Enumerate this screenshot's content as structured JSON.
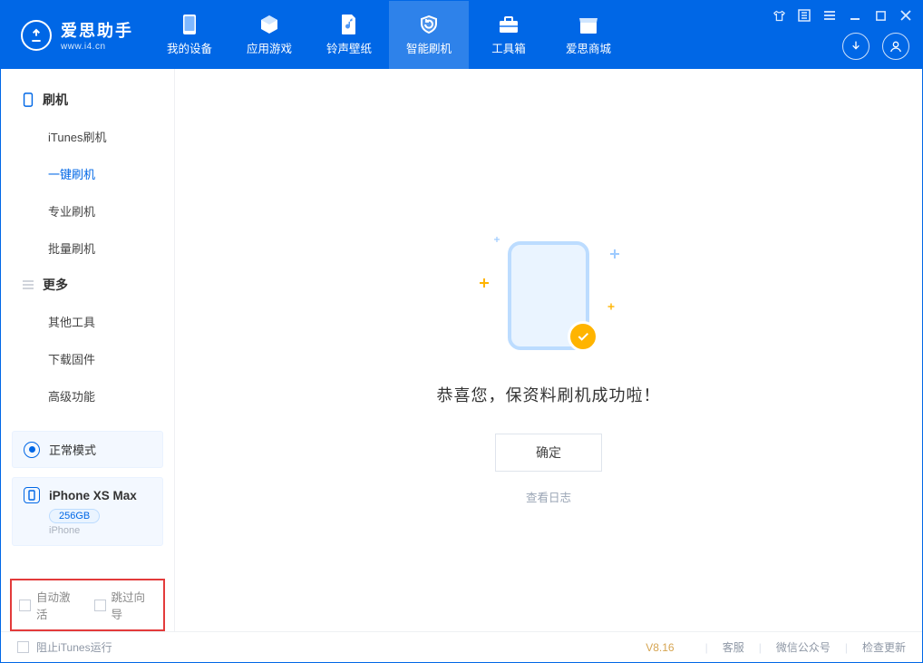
{
  "app": {
    "name_cn": "爱思助手",
    "name_en": "www.i4.cn"
  },
  "nav": {
    "device": "我的设备",
    "apps": "应用游戏",
    "ringtones": "铃声壁纸",
    "flash": "智能刷机",
    "toolbox": "工具箱",
    "store": "爱思商城"
  },
  "sidebar": {
    "group_flash": {
      "title": "刷机"
    },
    "items_flash": {
      "itunes": "iTunes刷机",
      "oneclick": "一键刷机",
      "pro": "专业刷机",
      "batch": "批量刷机"
    },
    "group_more": {
      "title": "更多"
    },
    "items_more": {
      "other": "其他工具",
      "firmware": "下载固件",
      "advanced": "高级功能"
    },
    "mode_label": "正常模式",
    "device": {
      "name": "iPhone XS Max",
      "capacity": "256GB",
      "type": "iPhone"
    },
    "options": {
      "auto_activate": "自动激活",
      "skip_guide": "跳过向导"
    }
  },
  "main": {
    "success_msg": "恭喜您，保资料刷机成功啦！",
    "confirm": "确定",
    "view_log": "查看日志"
  },
  "statusbar": {
    "block_itunes": "阻止iTunes运行",
    "version": "V8.16",
    "support": "客服",
    "wechat": "微信公众号",
    "check_update": "检查更新"
  }
}
